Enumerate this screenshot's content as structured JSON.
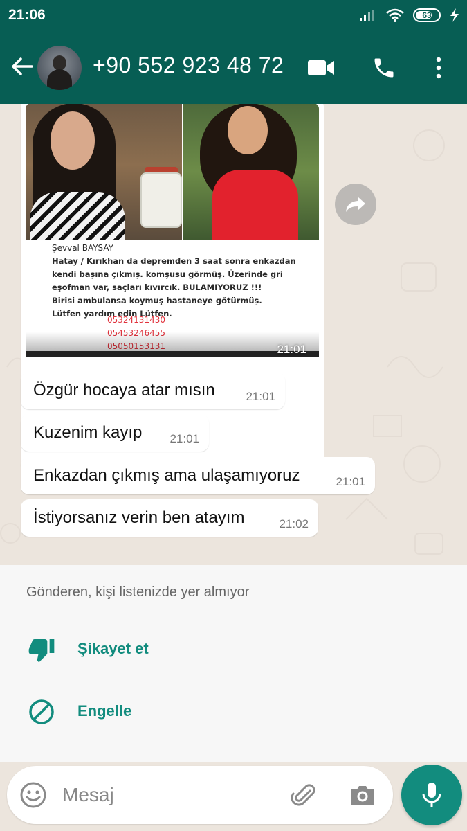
{
  "status_bar": {
    "time": "21:06",
    "battery_level": "63"
  },
  "header": {
    "contact_name": "+90 552 923 48 72"
  },
  "messages": {
    "image": {
      "caption_name": "Şevval BAYSAY",
      "caption_lines": [
        "Hatay / Kırıkhan da depremden 3 saat sonra enkazdan",
        "kendi başına çıkmış. komşusu görmüş. Üzerinde gri",
        "eşofman var, saçları kıvırcık. BULAMIYORUZ !!!",
        "Birisi ambulansa koymuş hastaneye götürmüş.",
        "Lütfen yardım edin Lütfen."
      ],
      "phones": [
        "05324131430",
        "05453246455",
        "05050153131"
      ],
      "time": "21:01"
    },
    "text": [
      {
        "text": "Özgür hocaya atar mısın",
        "time": "21:01"
      },
      {
        "text": "Kuzenim kayıp",
        "time": "21:01"
      },
      {
        "text": "Enkazdan çıkmış ama ulaşamıyoruz",
        "time": "21:01"
      },
      {
        "text": "İstiyorsanız verin ben atayım",
        "time": "21:02"
      }
    ]
  },
  "unknown_sender": {
    "note": "Gönderen, kişi listenizde yer almıyor",
    "report_label": "Şikayet et",
    "block_label": "Engelle"
  },
  "composer": {
    "placeholder": "Mesaj"
  },
  "colors": {
    "header_green": "#075e54",
    "accent_teal": "#128c7e",
    "chat_background": "#ece5dd",
    "phone_red": "#e0313b"
  }
}
